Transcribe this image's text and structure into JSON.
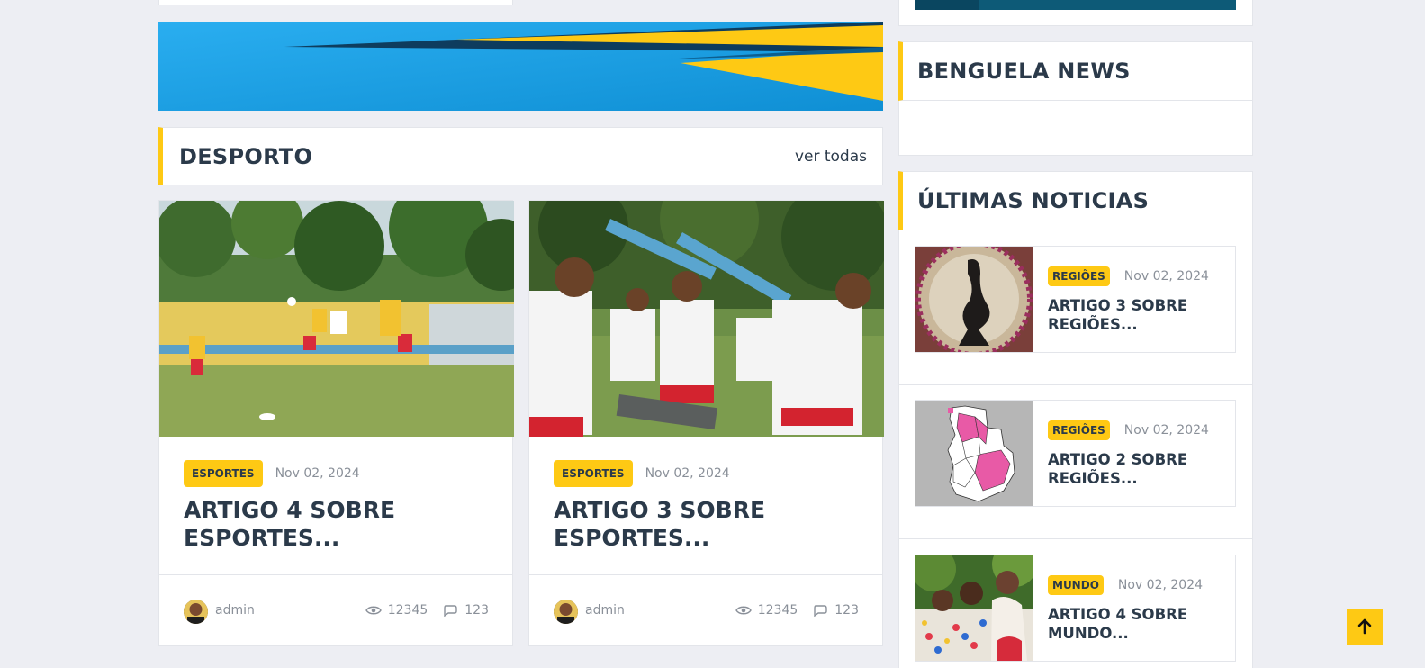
{
  "desporto": {
    "title": "DESPORTO",
    "ver_todas": "ver todas",
    "articles": [
      {
        "category": "ESPORTES",
        "date": "Nov 02, 2024",
        "title": "ARTIGO 4 SOBRE ESPORTES...",
        "author": "admin",
        "views": "12345",
        "comments": "123"
      },
      {
        "category": "ESPORTES",
        "date": "Nov 02, 2024",
        "title": "ARTIGO 3 SOBRE ESPORTES...",
        "author": "admin",
        "views": "12345",
        "comments": "123"
      }
    ]
  },
  "sidebar": {
    "benguela_title": "BENGUELA NEWS",
    "ultimas_title": "ÚLTIMAS NOTICIAS",
    "items": [
      {
        "category": "REGIÕES",
        "date": "Nov 02, 2024",
        "title": "ARTIGO 3 SOBRE REGIÕES..."
      },
      {
        "category": "REGIÕES",
        "date": "Nov 02, 2024",
        "title": "ARTIGO 2 SOBRE REGIÕES..."
      },
      {
        "category": "MUNDO",
        "date": "Nov 02, 2024",
        "title": "ARTIGO 4 SOBRE MUNDO..."
      }
    ]
  },
  "colors": {
    "accent": "#fec914",
    "heading": "#2b3a4a",
    "muted": "#8a9099",
    "background": "#edeef3"
  },
  "icons": {
    "views": "eye-icon",
    "comments": "comment-icon",
    "back_to_top": "arrow-up-icon"
  }
}
